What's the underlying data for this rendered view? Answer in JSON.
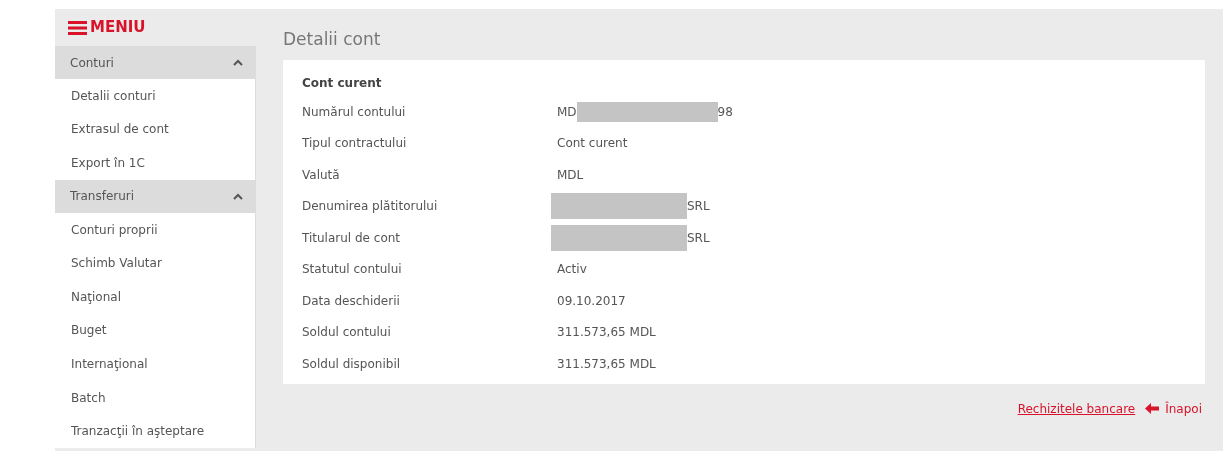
{
  "menu": {
    "label": "MENIU"
  },
  "sidebar": {
    "sections": [
      {
        "title": "Conturi",
        "expanded": true,
        "items": [
          "Detalii conturi",
          "Extrasul de cont",
          "Export în 1C"
        ]
      },
      {
        "title": "Transferuri",
        "expanded": true,
        "items": [
          "Conturi proprii",
          "Schimb Valutar",
          "Naţional",
          "Buget",
          "Internaţional",
          "Batch",
          "Tranzacţii în aşteptare"
        ]
      }
    ]
  },
  "page_title": "Detalii cont",
  "card": {
    "title": "Cont curent",
    "rows": [
      {
        "label": "Numărul contului",
        "kind": "masked_line",
        "prefix": "MD",
        "suffix": "98"
      },
      {
        "label": "Tipul contractului",
        "value": "Cont curent"
      },
      {
        "label": "Valută",
        "value": "MDL"
      },
      {
        "label": "Denumirea plătitorului",
        "kind": "masked_block",
        "suffix": "SRL"
      },
      {
        "label": "Titularul de cont",
        "kind": "masked_block",
        "suffix": "SRL"
      },
      {
        "label": "Statutul contului",
        "value": "Activ"
      },
      {
        "label": "Data deschiderii",
        "value": "09.10.2017"
      },
      {
        "label": "Soldul contului",
        "value": "311.573,65 MDL"
      },
      {
        "label": "Soldul disponibil",
        "value": "311.573,65 MDL"
      }
    ]
  },
  "footer_links": {
    "requisites": "Rechizitele bancare",
    "back": "Înapoi"
  }
}
